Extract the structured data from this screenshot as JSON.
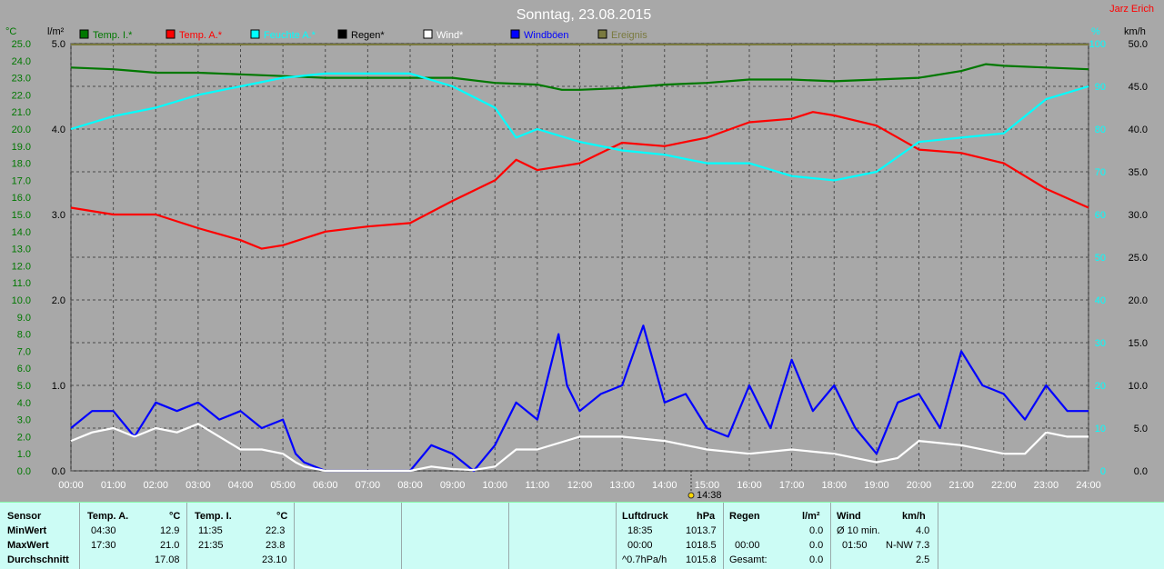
{
  "header": {
    "title": "Sonntag, 23.08.2015",
    "credit": "Jarz Erich",
    "now_marker": "14:38"
  },
  "legend": [
    {
      "label": "Temp. I.*",
      "color": "#007800"
    },
    {
      "label": "Temp. A.*",
      "color": "#ff0000"
    },
    {
      "label": "Feuchte A.*",
      "color": "#00ffff"
    },
    {
      "label": "Regen*",
      "color": "#000000"
    },
    {
      "label": "Wind*",
      "color": "#ffffff"
    },
    {
      "label": "Windböen",
      "color": "#0000ff"
    },
    {
      "label": "Ereignis",
      "color": "#7a7a3f"
    }
  ],
  "chart_data": {
    "type": "line",
    "x_ticks": [
      "00:00",
      "01:00",
      "02:00",
      "03:00",
      "04:00",
      "05:00",
      "06:00",
      "07:00",
      "08:00",
      "09:00",
      "10:00",
      "11:00",
      "12:00",
      "13:00",
      "14:00",
      "15:00",
      "16:00",
      "17:00",
      "18:00",
      "19:00",
      "20:00",
      "21:00",
      "22:00",
      "23:00",
      "24:00"
    ],
    "axes": {
      "temp": {
        "label": "°C",
        "min": 0,
        "max": 25,
        "ticks": [
          "0.0",
          "1.0",
          "2.0",
          "3.0",
          "4.0",
          "5.0",
          "6.0",
          "7.0",
          "8.0",
          "9.0",
          "10.0",
          "11.0",
          "12.0",
          "13.0",
          "14.0",
          "15.0",
          "16.0",
          "17.0",
          "18.0",
          "19.0",
          "20.0",
          "21.0",
          "22.0",
          "23.0",
          "24.0",
          "25.0"
        ]
      },
      "rain": {
        "label": "l/m²",
        "min": 0,
        "max": 5,
        "ticks": [
          "0.0",
          "1.0",
          "2.0",
          "3.0",
          "4.0",
          "5.0"
        ]
      },
      "hum": {
        "label": "%",
        "min": 0,
        "max": 100,
        "ticks": [
          "0",
          "10",
          "20",
          "30",
          "40",
          "50",
          "60",
          "70",
          "80",
          "90",
          "100"
        ]
      },
      "wind": {
        "label": "km/h",
        "min": 0,
        "max": 50,
        "ticks": [
          "0.0",
          "5.0",
          "10.0",
          "15.0",
          "20.0",
          "25.0",
          "30.0",
          "35.0",
          "40.0",
          "45.0",
          "50.0"
        ]
      }
    },
    "series": [
      {
        "name": "Temp. I.*",
        "axis": "temp",
        "color": "#007800",
        "points": [
          [
            0,
            23.6
          ],
          [
            1,
            23.5
          ],
          [
            2,
            23.3
          ],
          [
            3,
            23.3
          ],
          [
            4,
            23.2
          ],
          [
            5,
            23.1
          ],
          [
            6,
            23.0
          ],
          [
            7,
            23.0
          ],
          [
            8,
            23.0
          ],
          [
            9,
            23.0
          ],
          [
            10,
            22.7
          ],
          [
            11,
            22.6
          ],
          [
            11.58,
            22.3
          ],
          [
            12,
            22.3
          ],
          [
            13,
            22.4
          ],
          [
            14,
            22.6
          ],
          [
            15,
            22.7
          ],
          [
            16,
            22.9
          ],
          [
            17,
            22.9
          ],
          [
            18,
            22.8
          ],
          [
            19,
            22.9
          ],
          [
            20,
            23.0
          ],
          [
            21,
            23.4
          ],
          [
            21.58,
            23.8
          ],
          [
            22,
            23.7
          ],
          [
            23,
            23.6
          ],
          [
            24,
            23.5
          ]
        ]
      },
      {
        "name": "Temp. A.*",
        "axis": "temp",
        "color": "#ff0000",
        "points": [
          [
            0,
            15.4
          ],
          [
            1,
            15.0
          ],
          [
            2,
            15.0
          ],
          [
            3,
            14.2
          ],
          [
            4,
            13.5
          ],
          [
            4.5,
            13.0
          ],
          [
            5,
            13.2
          ],
          [
            6,
            14.0
          ],
          [
            7,
            14.3
          ],
          [
            8,
            14.5
          ],
          [
            9,
            15.8
          ],
          [
            10,
            17.0
          ],
          [
            10.5,
            18.2
          ],
          [
            11,
            17.6
          ],
          [
            12,
            18.0
          ],
          [
            12.5,
            18.6
          ],
          [
            13,
            19.2
          ],
          [
            14,
            19.0
          ],
          [
            15,
            19.5
          ],
          [
            16,
            20.4
          ],
          [
            17,
            20.6
          ],
          [
            17.5,
            21.0
          ],
          [
            18,
            20.8
          ],
          [
            19,
            20.2
          ],
          [
            20,
            18.8
          ],
          [
            21,
            18.6
          ],
          [
            22,
            18.0
          ],
          [
            23,
            16.5
          ],
          [
            24,
            15.4
          ]
        ]
      },
      {
        "name": "Feuchte A.*",
        "axis": "hum",
        "color": "#00ffff",
        "points": [
          [
            0,
            80
          ],
          [
            1,
            83
          ],
          [
            2,
            85
          ],
          [
            3,
            88
          ],
          [
            4,
            90
          ],
          [
            5,
            92
          ],
          [
            6,
            93
          ],
          [
            7,
            93
          ],
          [
            8,
            93
          ],
          [
            9,
            90
          ],
          [
            10,
            85
          ],
          [
            10.5,
            78
          ],
          [
            11,
            80
          ],
          [
            12,
            77
          ],
          [
            13,
            75
          ],
          [
            14,
            74
          ],
          [
            15,
            72
          ],
          [
            16,
            72
          ],
          [
            17,
            69
          ],
          [
            18,
            68
          ],
          [
            19,
            70
          ],
          [
            20,
            77
          ],
          [
            21,
            78
          ],
          [
            22,
            79
          ],
          [
            23,
            87
          ],
          [
            24,
            90
          ]
        ]
      },
      {
        "name": "Windböen",
        "axis": "wind",
        "color": "#0000ff",
        "points": [
          [
            0,
            5
          ],
          [
            0.5,
            7
          ],
          [
            1,
            7
          ],
          [
            1.5,
            4
          ],
          [
            2,
            8
          ],
          [
            2.5,
            7
          ],
          [
            3,
            8
          ],
          [
            3.5,
            6
          ],
          [
            4,
            7
          ],
          [
            4.5,
            5
          ],
          [
            5,
            6
          ],
          [
            5.3,
            2
          ],
          [
            5.5,
            1
          ],
          [
            6,
            0
          ],
          [
            7,
            0
          ],
          [
            8,
            0
          ],
          [
            8.5,
            3
          ],
          [
            9,
            2
          ],
          [
            9.5,
            0
          ],
          [
            10,
            3
          ],
          [
            10.5,
            8
          ],
          [
            11,
            6
          ],
          [
            11.5,
            16
          ],
          [
            11.7,
            10
          ],
          [
            12,
            7
          ],
          [
            12.5,
            9
          ],
          [
            13,
            10
          ],
          [
            13.5,
            17
          ],
          [
            14,
            8
          ],
          [
            14.5,
            9
          ],
          [
            15,
            5
          ],
          [
            15.5,
            4
          ],
          [
            16,
            10
          ],
          [
            16.5,
            5
          ],
          [
            17,
            13
          ],
          [
            17.5,
            7
          ],
          [
            18,
            10
          ],
          [
            18.5,
            5
          ],
          [
            19,
            2
          ],
          [
            19.5,
            8
          ],
          [
            20,
            9
          ],
          [
            20.5,
            5
          ],
          [
            21,
            14
          ],
          [
            21.5,
            10
          ],
          [
            22,
            9
          ],
          [
            22.5,
            6
          ],
          [
            23,
            10
          ],
          [
            23.5,
            7
          ],
          [
            24,
            7
          ]
        ]
      },
      {
        "name": "Wind*",
        "axis": "wind",
        "color": "#ffffff",
        "points": [
          [
            0,
            3.5
          ],
          [
            0.5,
            4.5
          ],
          [
            1,
            5
          ],
          [
            1.5,
            4
          ],
          [
            2,
            5
          ],
          [
            2.5,
            4.5
          ],
          [
            3,
            5.5
          ],
          [
            3.5,
            4
          ],
          [
            4,
            2.5
          ],
          [
            4.5,
            2.5
          ],
          [
            5,
            2
          ],
          [
            5.3,
            1
          ],
          [
            5.5,
            0.5
          ],
          [
            6,
            0
          ],
          [
            8,
            0
          ],
          [
            8.5,
            0.5
          ],
          [
            9,
            0.2
          ],
          [
            9.5,
            0.1
          ],
          [
            10,
            0.5
          ],
          [
            10.5,
            2.5
          ],
          [
            11,
            2.5
          ],
          [
            12,
            4
          ],
          [
            13,
            4
          ],
          [
            14,
            3.5
          ],
          [
            15,
            2.5
          ],
          [
            16,
            2
          ],
          [
            17,
            2.5
          ],
          [
            18,
            2
          ],
          [
            19,
            1
          ],
          [
            19.5,
            1.5
          ],
          [
            20,
            3.5
          ],
          [
            21,
            3
          ],
          [
            22,
            2
          ],
          [
            22.5,
            2
          ],
          [
            23,
            4.5
          ],
          [
            23.5,
            4
          ],
          [
            24,
            4
          ]
        ]
      }
    ]
  },
  "summary": {
    "headers": {
      "sensor": "Sensor",
      "temp_a": "Temp. A.",
      "temp_a_unit": "°C",
      "temp_i": "Temp. I.",
      "temp_i_unit": "°C",
      "pressure": "Luftdruck",
      "pressure_unit": "hPa",
      "rain": "Regen",
      "rain_unit": "l/m²",
      "wind": "Wind",
      "wind_unit": "km/h"
    },
    "rows": {
      "min": "MinWert",
      "max": "MaxWert",
      "avg": "Durchschnitt"
    },
    "temp_a": {
      "min_time": "04:30",
      "min_val": "12.9",
      "max_time": "17:30",
      "max_val": "21.0",
      "avg": "17.08"
    },
    "temp_i": {
      "min_time": "11:35",
      "min_val": "22.3",
      "max_time": "21:35",
      "max_val": "23.8",
      "avg": "23.10"
    },
    "pressure": {
      "r1_time": "18:35",
      "r1_val": "1013.7",
      "r2_time": "00:00",
      "r2_val": "1018.5",
      "r3_label": "^0.7hPa/h",
      "r3_val": "1015.8"
    },
    "rain": {
      "r2_time": "00:00",
      "r2_val": "0.0",
      "r3_label": "Gesamt:",
      "r3_val": "0.0",
      "r1_val": "0.0"
    },
    "wind": {
      "r1_label": "Ø 10 min.",
      "r1_val": "4.0",
      "r2_time": "01:50",
      "r2_val": "N-NW 7.3",
      "r3_val": "2.5"
    }
  }
}
